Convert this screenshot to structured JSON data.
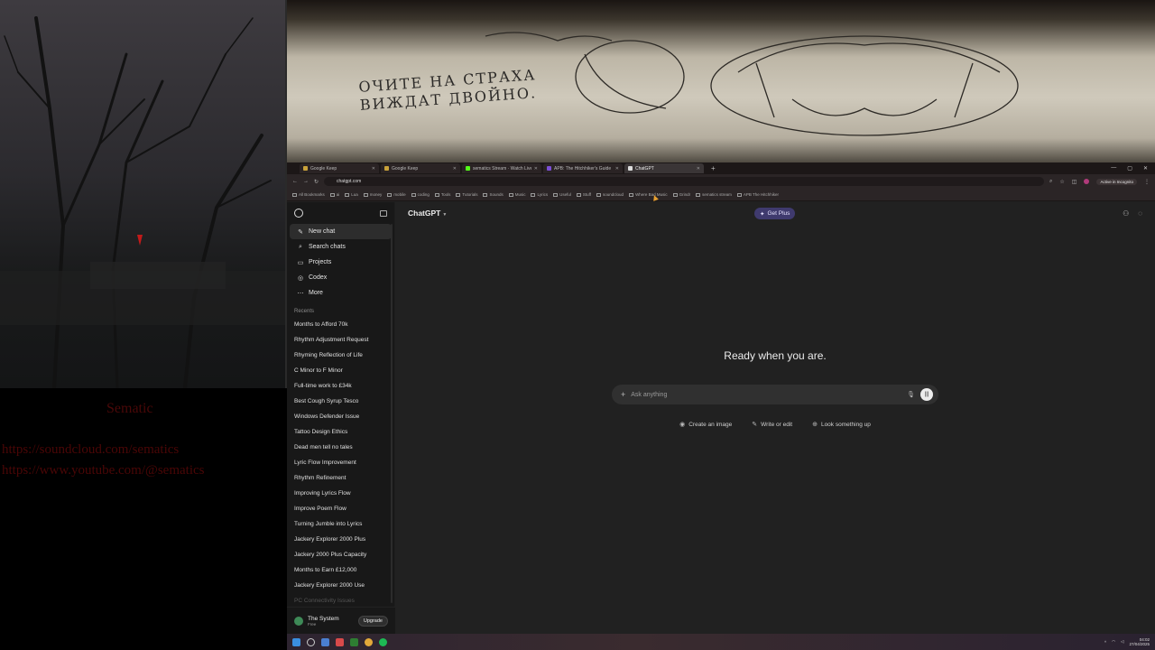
{
  "overlay": {
    "name": "Sematic",
    "links": [
      "https://soundcloud.com/sematics",
      "https://www.youtube.com/@sematics"
    ]
  },
  "wall": {
    "graffiti_line1": "ОЧИТЕ НА СТРАХА",
    "graffiti_line2": "ВИЖДАТ ДВОЙНО."
  },
  "browser": {
    "tabs": [
      {
        "label": "Google Keep",
        "active": false
      },
      {
        "label": "Google Keep",
        "active": false
      },
      {
        "label": "sematics Stream · Watch Live",
        "active": false
      },
      {
        "label": "APB: The Hitchhiker's Guide",
        "active": false
      },
      {
        "label": "ChatGPT",
        "active": true
      }
    ],
    "new_tab": "+",
    "url": "chatgpt.com",
    "signin_pill": "Active in Incognito",
    "bookmarks": [
      "All Bookmarks",
      "ai",
      "Lua",
      "money",
      "mobile",
      "coding",
      "Tools",
      "Tutorials",
      "Sounds",
      "Music",
      "Lyrics",
      "Useful",
      "Stuff",
      "soundcloud",
      "Where Bad Music",
      "Grindr",
      "sematics stream",
      "APB The Hitchhiker"
    ]
  },
  "sidebar": {
    "nav": [
      {
        "label": "New chat",
        "icon": "✎",
        "icon_name": "new-chat-icon"
      },
      {
        "label": "Search chats",
        "icon": "⌕",
        "icon_name": "search-icon"
      },
      {
        "label": "Projects",
        "icon": "▭",
        "icon_name": "folder-icon"
      },
      {
        "label": "Codex",
        "icon": "◎",
        "icon_name": "codex-icon"
      },
      {
        "label": "More",
        "icon": "⋯",
        "icon_name": "more-icon"
      }
    ],
    "recents_label": "Recents",
    "recents": [
      "Months to Afford 70k",
      "Rhythm Adjustment Request",
      "Rhyming Reflection of Life",
      "C Minor to F Minor",
      "Full-time work to £34k",
      "Best Cough Syrup Tesco",
      "Windows Defender Issue",
      "Tattoo Design Ethics",
      "Dead men tell no tales",
      "Lyric Flow Improvement",
      "Rhythm Refinement",
      "Improving Lyrics Flow",
      "Improve Poem Flow",
      "Turning Jumble into Lyrics",
      "Jackery Explorer 2000 Plus",
      "Jackery 2000 Plus Capacity",
      "Months to Earn £12,000",
      "Jackery Explorer 2000 Use",
      "PC Connectivity Issues"
    ],
    "user": {
      "name": "The System",
      "plan": "Free",
      "upgrade": "Upgrade"
    }
  },
  "main": {
    "model": "ChatGPT",
    "get_plus": "Get Plus",
    "hero": "Ready when you are.",
    "composer_placeholder": "Ask anything",
    "chips": [
      {
        "label": "Create an image",
        "icon": "◉",
        "icon_name": "image-icon"
      },
      {
        "label": "Write or edit",
        "icon": "✎",
        "icon_name": "pen-icon"
      },
      {
        "label": "Look something up",
        "icon": "⊕",
        "icon_name": "globe-icon"
      }
    ]
  },
  "taskbar": {
    "time": "04:02",
    "date": "27/04/2025"
  }
}
